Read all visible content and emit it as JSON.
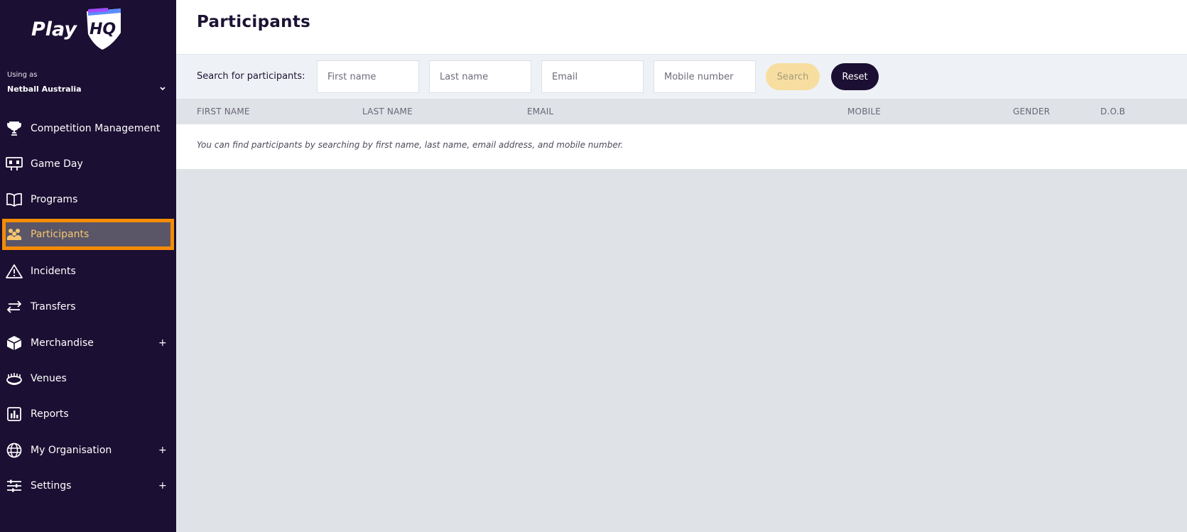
{
  "app": {
    "logo_text": "PlayHQ"
  },
  "org": {
    "label": "Using as",
    "name": "Netball Australia"
  },
  "sidebar": {
    "items": [
      {
        "label": "Competition Management",
        "icon": "trophy-icon",
        "expandable": false,
        "active": false
      },
      {
        "label": "Game Day",
        "icon": "scoreboard-icon",
        "expandable": false,
        "active": false
      },
      {
        "label": "Programs",
        "icon": "book-icon",
        "expandable": false,
        "active": false
      },
      {
        "label": "Participants",
        "icon": "people-icon",
        "expandable": false,
        "active": true
      },
      {
        "label": "Incidents",
        "icon": "warning-icon",
        "expandable": false,
        "active": false
      },
      {
        "label": "Transfers",
        "icon": "transfer-arrows-icon",
        "expandable": false,
        "active": false
      },
      {
        "label": "Merchandise",
        "icon": "box-icon",
        "expandable": true,
        "active": false
      },
      {
        "label": "Venues",
        "icon": "stadium-icon",
        "expandable": false,
        "active": false
      },
      {
        "label": "Reports",
        "icon": "report-icon",
        "expandable": false,
        "active": false
      },
      {
        "label": "My Organisation",
        "icon": "globe-icon",
        "expandable": true,
        "active": false
      },
      {
        "label": "Settings",
        "icon": "sliders-icon",
        "expandable": true,
        "active": false
      }
    ],
    "expand_symbol": "+"
  },
  "header": {
    "title": "Participants"
  },
  "search": {
    "label": "Search for participants:",
    "first_name_placeholder": "First name",
    "last_name_placeholder": "Last name",
    "email_placeholder": "Email",
    "mobile_placeholder": "Mobile number",
    "search_label": "Search",
    "reset_label": "Reset"
  },
  "table": {
    "columns": [
      "FIRST NAME",
      "LAST NAME",
      "EMAIL",
      "MOBILE",
      "GENDER",
      "D.O.B"
    ],
    "empty_message": "You can find participants by searching by first name, last name, email address, and mobile number."
  },
  "colors": {
    "sidebar_bg": "#1b0f33",
    "active_highlight_border": "#f48c06",
    "active_label": "#f6c66f",
    "search_button_disabled": "#f7dea0",
    "reset_button": "#1b0f33"
  }
}
